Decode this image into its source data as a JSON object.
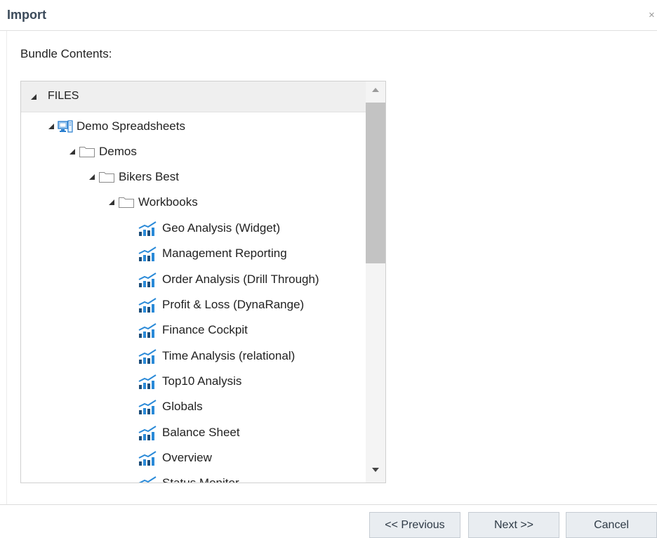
{
  "dialog": {
    "title": "Import",
    "close_glyph": "×"
  },
  "bundle": {
    "label": "Bundle Contents:"
  },
  "tree": {
    "root_label": "FILES",
    "nodes": [
      {
        "label": "Demo Spreadsheets",
        "icon": "computer-icon"
      },
      {
        "label": "Demos",
        "icon": "folder-icon"
      },
      {
        "label": "Bikers Best",
        "icon": "folder-icon"
      },
      {
        "label": "Workbooks",
        "icon": "folder-icon"
      },
      {
        "label": "Geo Analysis (Widget)",
        "icon": "report-icon"
      },
      {
        "label": "Management Reporting",
        "icon": "report-icon"
      },
      {
        "label": "Order Analysis (Drill Through)",
        "icon": "report-icon"
      },
      {
        "label": "Profit & Loss (DynaRange)",
        "icon": "report-icon"
      },
      {
        "label": "Finance Cockpit",
        "icon": "report-icon"
      },
      {
        "label": "Time Analysis (relational)",
        "icon": "report-icon"
      },
      {
        "label": "Top10 Analysis",
        "icon": "report-icon"
      },
      {
        "label": "Globals",
        "icon": "report-icon"
      },
      {
        "label": "Balance Sheet",
        "icon": "report-icon"
      },
      {
        "label": "Overview",
        "icon": "report-icon"
      },
      {
        "label": "Status Monitor",
        "icon": "report-icon"
      }
    ]
  },
  "buttons": {
    "previous": "<< Previous",
    "next": "Next >>",
    "cancel": "Cancel"
  },
  "colors": {
    "title": "#3b4a5a",
    "button_bg": "#e9edf1",
    "report_icon_blue": "#2a8ad8",
    "report_icon_dark": "#1f4e79",
    "folder_stroke": "#8a8a8a"
  }
}
